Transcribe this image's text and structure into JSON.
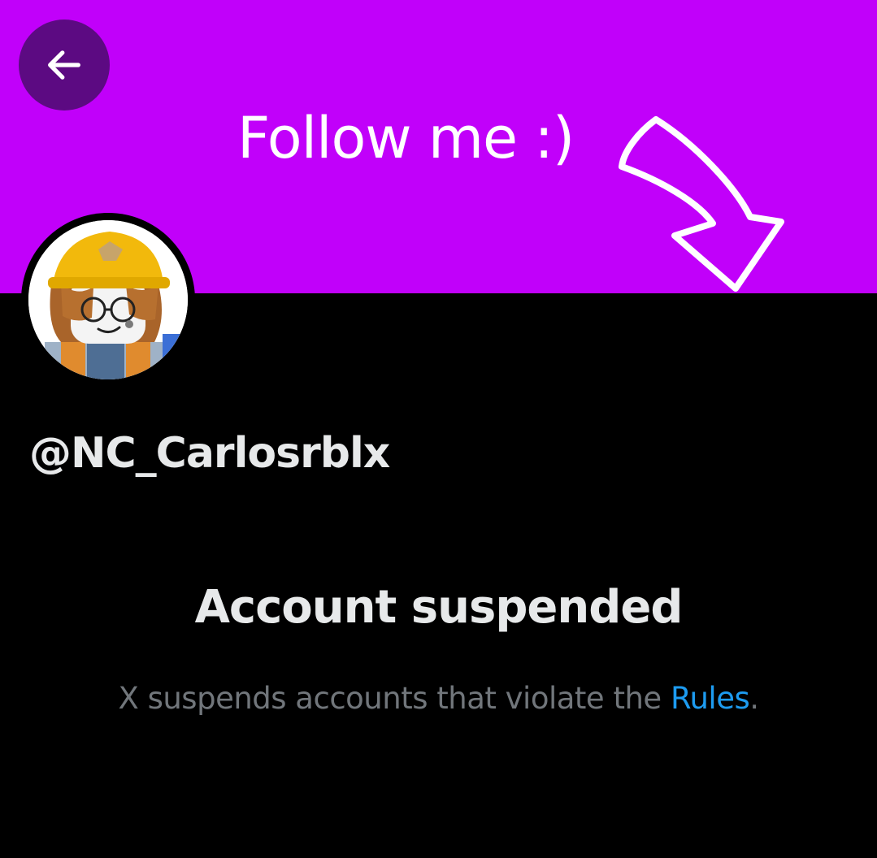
{
  "header": {
    "back_icon": "arrow-left-icon",
    "banner_text": "Follow me :)",
    "banner_color": "#c100fa",
    "banner_arrow_icon": "curved-arrow-down-right-icon"
  },
  "profile": {
    "avatar": "roblox-construction-worker-avatar",
    "handle": "@NC_Carlosrblx"
  },
  "suspension": {
    "title": "Account suspended",
    "message": "X suspends accounts that violate the",
    "link_label": "Rules",
    "message_end": ".",
    "link_color": "#1d9bf0"
  }
}
